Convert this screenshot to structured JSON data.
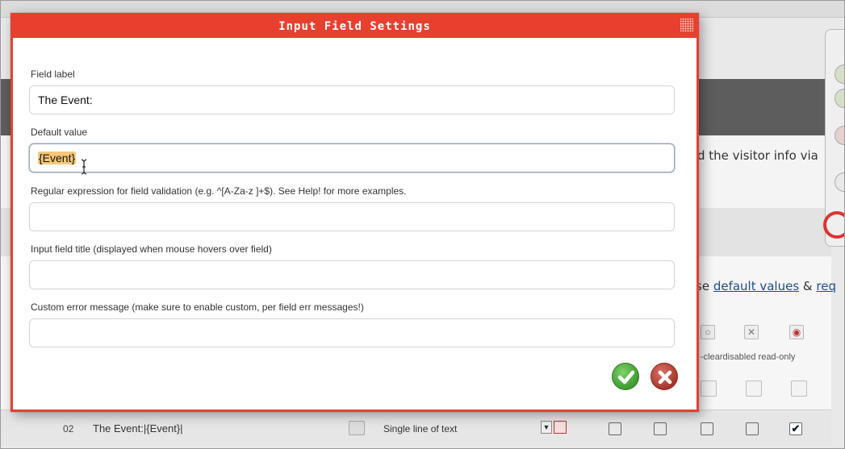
{
  "dialog": {
    "title": "Input Field Settings",
    "accent_color": "#e8402f",
    "fields": [
      {
        "label": "Field label",
        "value": "The Event:",
        "placeholder": ""
      },
      {
        "label": "Default value",
        "value": "{Event}",
        "placeholder": ""
      },
      {
        "label": "Regular expression for field validation (e.g. ^[A-Za-z ]+$). See Help! for more examples.",
        "value": "",
        "placeholder": ""
      },
      {
        "label": "Input field title (displayed when mouse hovers over field)",
        "value": "",
        "placeholder": ""
      },
      {
        "label": "Custom error message (make sure to enable custom, per field err messages!)",
        "value": "",
        "placeholder": ""
      }
    ],
    "ok_icon": "checkmark-icon",
    "cancel_icon": "close-icon"
  },
  "background": {
    "visitor_text": "d the visitor info via",
    "defaults_prefix": "se ",
    "defaults_link": "default values",
    "defaults_amp": " & ",
    "defaults_link2": "req",
    "cleardisabled_text": "-cleardisabled read-only",
    "row": {
      "number": "02",
      "label": "The Event:|{Event}|",
      "type": "Single line of text",
      "checked_last": "✔"
    }
  }
}
